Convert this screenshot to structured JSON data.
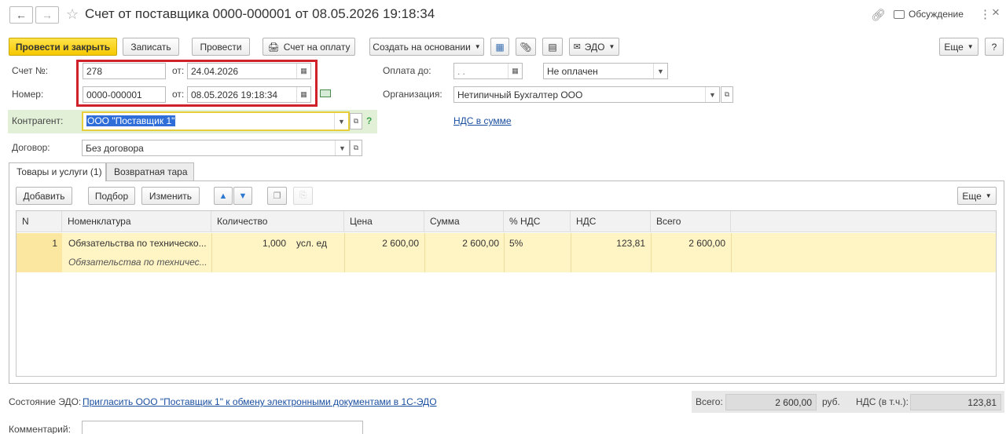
{
  "window": {
    "title": "Счет от поставщика 0000-000001 от 08.05.2026 19:18:34",
    "discuss_label": "Обсуждение"
  },
  "toolbar": {
    "post_close": "Провести и закрыть",
    "save": "Записать",
    "post": "Провести",
    "invoice_payment": "Счет на оплату",
    "create_based": "Создать на основании",
    "edo": "ЭДО",
    "more": "Еще"
  },
  "form": {
    "invoice_no_label": "Счет №:",
    "invoice_no": "278",
    "from_label_1": "от:",
    "invoice_date": "24.04.2026",
    "number_label": "Номер:",
    "number": "0000-000001",
    "from_label_2": "от:",
    "number_date": "08.05.2026 19:18:34",
    "pay_until_label": "Оплата до:",
    "pay_until": ". .",
    "pay_status": "Не оплачен",
    "org_label": "Организация:",
    "org": "Нетипичный Бухгалтер ООО",
    "contractor_label": "Контрагент:",
    "contractor": "ООО \"Поставщик 1\"",
    "help_mark": "?",
    "vat_link": "НДС в сумме",
    "contract_label": "Договор:",
    "contract": "Без договора"
  },
  "tabs": [
    {
      "label": "Товары и услуги (1)"
    },
    {
      "label": "Возвратная тара"
    }
  ],
  "table_toolbar": {
    "add": "Добавить",
    "select": "Подбор",
    "change": "Изменить",
    "more": "Еще"
  },
  "table": {
    "headers": [
      "N",
      "Номенклатура",
      "Количество",
      "Цена",
      "Сумма",
      "% НДС",
      "НДС",
      "Всего"
    ],
    "rows": [
      {
        "n": "1",
        "item": "Обязательства по техническо...",
        "item_sub": "Обязательства по техничес...",
        "qty": "1,000",
        "unit": "усл. ед",
        "price": "2 600,00",
        "sum": "2 600,00",
        "vat_rate": "5%",
        "vat": "123,81",
        "total": "2 600,00"
      }
    ]
  },
  "footer": {
    "edo_status_label": "Состояние ЭДО:",
    "edo_link": "Пригласить ООО \"Поставщик 1\" к обмену электронными документами в 1С-ЭДО",
    "total_label": "Всего:",
    "total": "2 600,00",
    "currency": "руб.",
    "vat_label": "НДС (в т.ч.):",
    "vat_total": "123,81",
    "comment_label": "Комментарий:"
  },
  "colors": {
    "primary_button": "#f6c800",
    "highlight_box": "#d0202a",
    "contractor_bg": "#e3f0d8",
    "selected_row": "#fff4c4",
    "link": "#1a4fa0"
  }
}
